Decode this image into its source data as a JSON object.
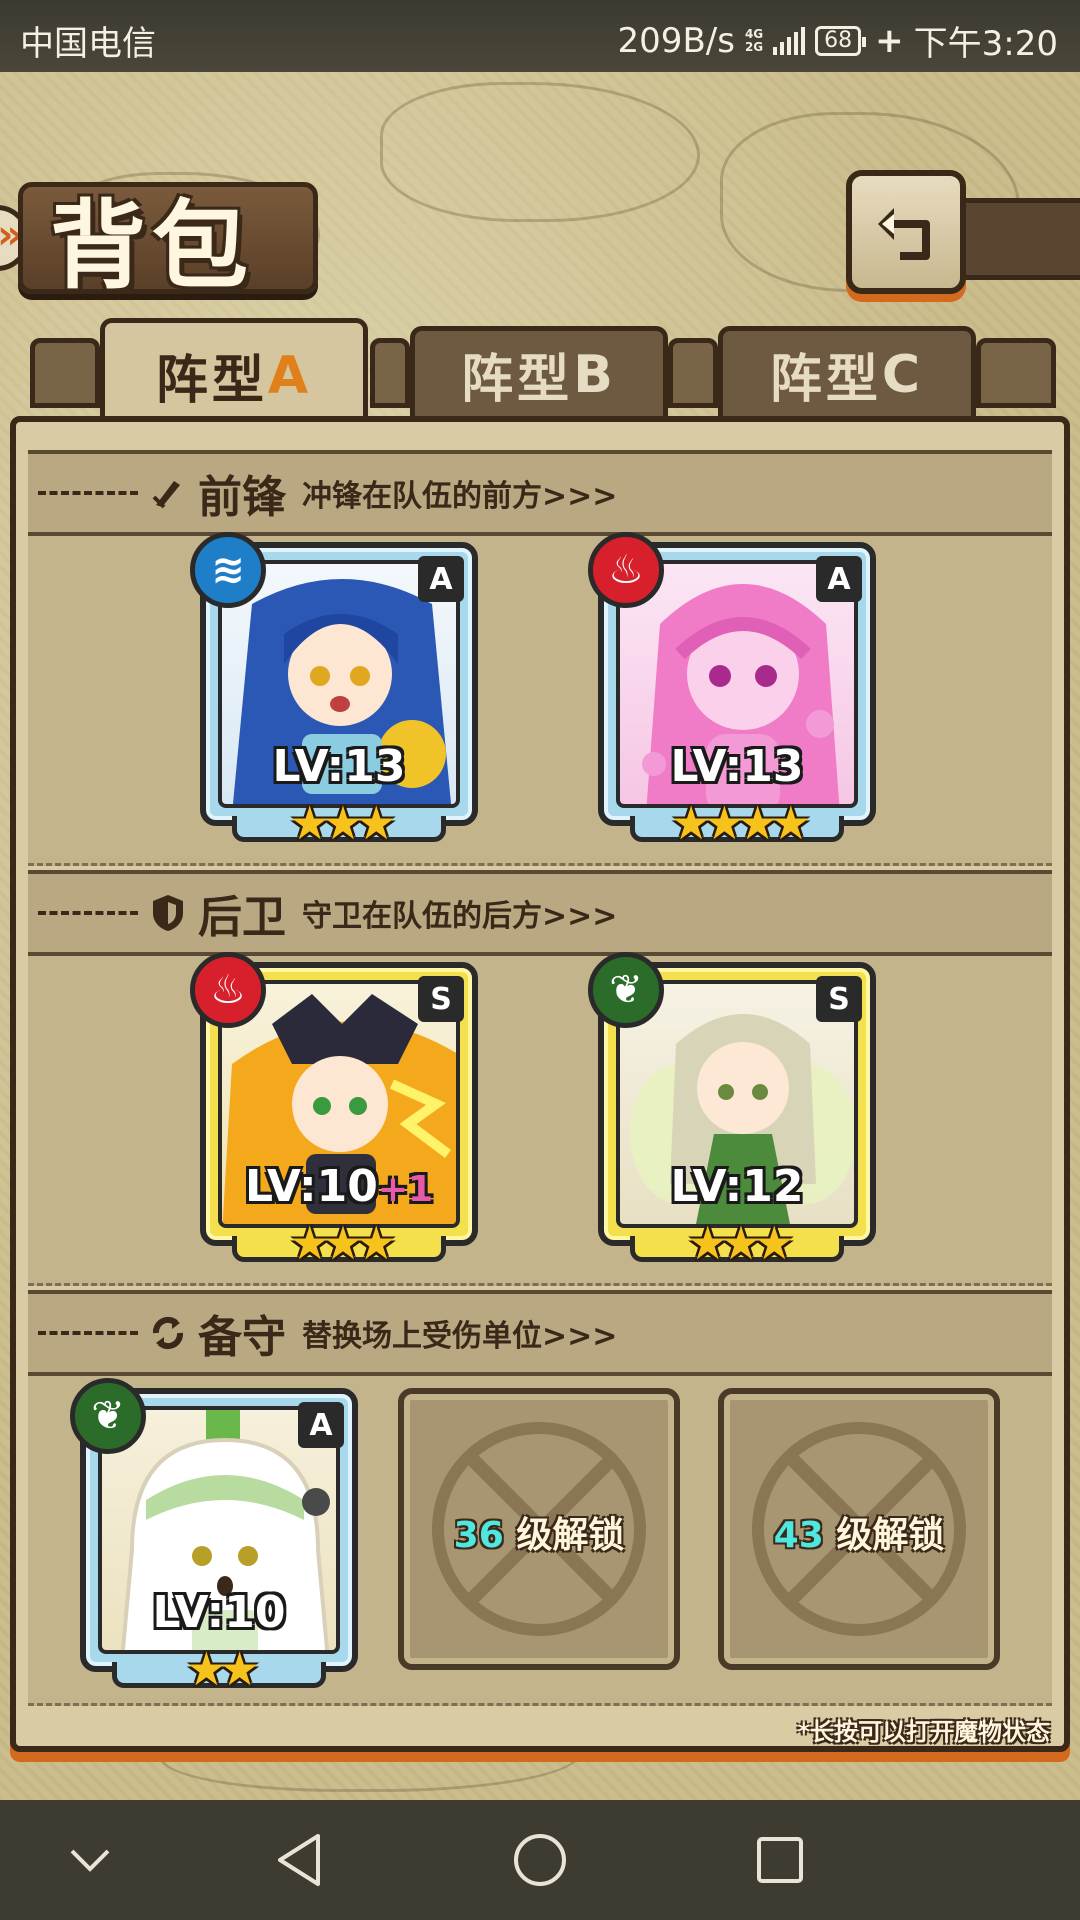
{
  "status_bar": {
    "carrier": "中国电信",
    "net_speed": "209B/s",
    "net_type_top": "4G",
    "net_type_bottom": "2G",
    "battery": "68",
    "time": "下午3:20"
  },
  "header": {
    "title": "背包",
    "back_icon": "back-arrow-icon"
  },
  "tabs": [
    {
      "label": "阵型",
      "letter": "A",
      "active": true
    },
    {
      "label": "阵型",
      "letter": "B",
      "active": false
    },
    {
      "label": "阵型",
      "letter": "C",
      "active": false
    }
  ],
  "sections": {
    "front": {
      "title": "前锋",
      "desc": "冲锋在队伍的前方>>>",
      "icon": "sword-icon"
    },
    "rear": {
      "title": "后卫",
      "desc": "守卫在队伍的后方>>>",
      "icon": "shield-icon"
    },
    "reserve": {
      "title": "备守",
      "desc": "替换场上受伤单位>>>",
      "icon": "swap-icon"
    }
  },
  "units": {
    "front_1": {
      "rank": "A",
      "element": "water",
      "level": "LV:13",
      "bonus": "",
      "stars": 3,
      "frame": "blue"
    },
    "front_2": {
      "rank": "A",
      "element": "fire",
      "level": "LV:13",
      "bonus": "",
      "stars": 4,
      "frame": "blue"
    },
    "rear_1": {
      "rank": "S",
      "element": "fire",
      "level": "LV:10",
      "bonus": "+1",
      "stars": 3,
      "frame": "yellow"
    },
    "rear_2": {
      "rank": "S",
      "element": "nature",
      "level": "LV:12",
      "bonus": "",
      "stars": 3,
      "frame": "yellow"
    },
    "reserve_1": {
      "rank": "A",
      "element": "nature",
      "level": "LV:10",
      "bonus": "",
      "stars": 2,
      "frame": "blue"
    }
  },
  "locked_slots": [
    {
      "level": "36",
      "suffix": "级解锁"
    },
    {
      "level": "43",
      "suffix": "级解锁"
    }
  ],
  "hint": "*长按可以打开魔物状态",
  "colors": {
    "water": "#1f7ec8",
    "fire": "#d8202c",
    "nature": "#2c6c2a",
    "accent_orange": "#d46a1e",
    "unlock_number": "#4ee8e0"
  }
}
